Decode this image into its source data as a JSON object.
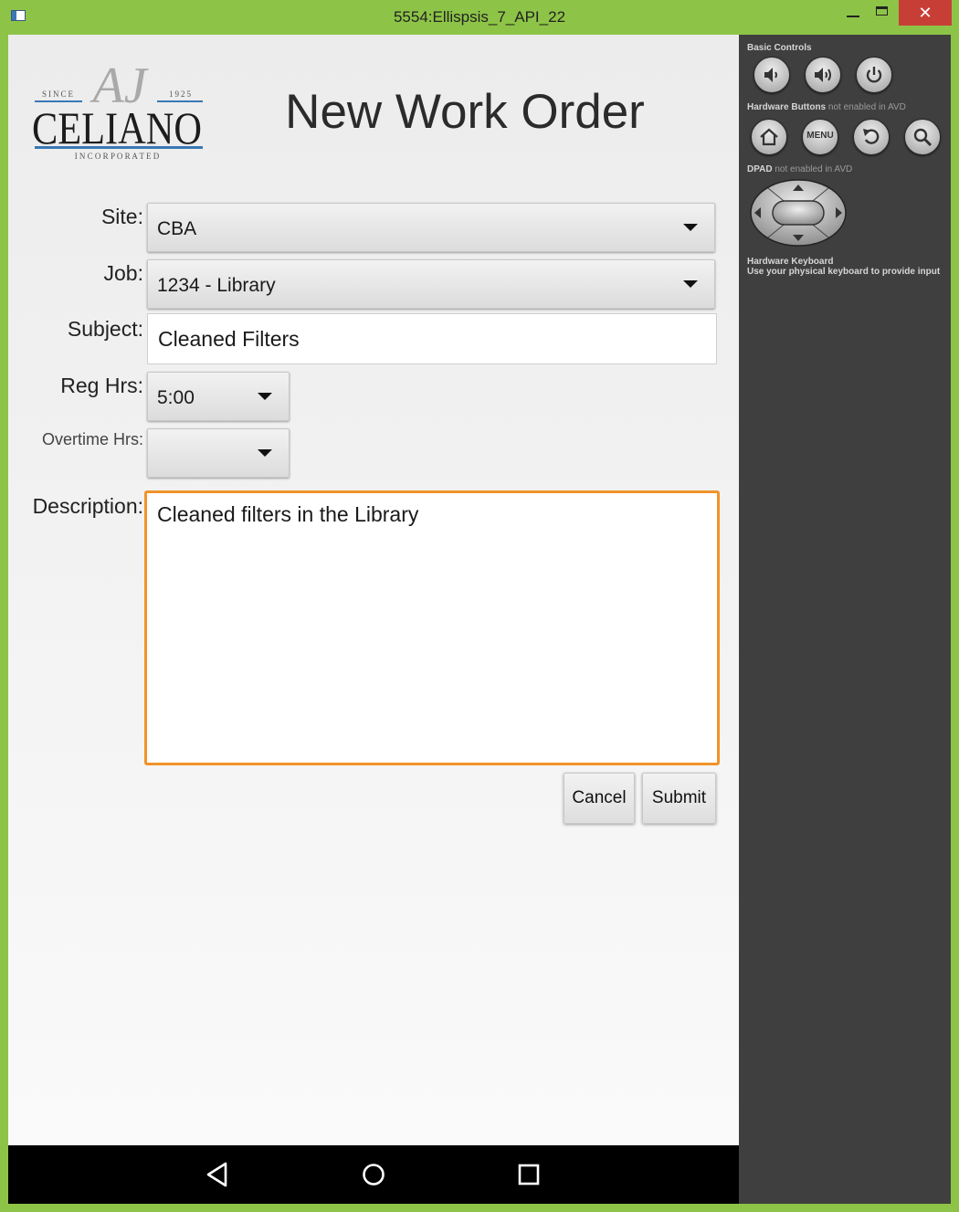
{
  "window": {
    "title": "5554:Ellispsis_7_API_22",
    "close_glyph": "✕"
  },
  "logo": {
    "monogram": "AJ",
    "since": "SINCE",
    "year": "1925",
    "name": "CELIANO",
    "sub": "I N C O R P O R A T E D"
  },
  "form": {
    "title": "New Work Order",
    "site": {
      "label": "Site:",
      "value": "CBA"
    },
    "job": {
      "label": "Job:",
      "value": "1234 - Library"
    },
    "subject": {
      "label": "Subject:",
      "value": "Cleaned Filters"
    },
    "reg_hrs": {
      "label": "Reg Hrs:",
      "value": "5:00"
    },
    "overtime_hrs": {
      "label": "Overtime Hrs:",
      "value": ""
    },
    "description": {
      "label": "Description:",
      "value": "Cleaned filters in the Library"
    },
    "cancel_label": "Cancel",
    "submit_label": "Submit"
  },
  "navbar": {
    "icons": [
      "back-icon",
      "home-icon",
      "recents-icon"
    ]
  },
  "panel": {
    "basic_controls": "Basic Controls",
    "hw_buttons": "Hardware Buttons",
    "hw_buttons_note": "not enabled in AVD",
    "menu_label": "MENU",
    "dpad": "DPAD",
    "dpad_note": "not enabled in AVD",
    "keyboard_title": "Hardware Keyboard",
    "keyboard_note": "Use your physical keyboard to provide input"
  },
  "colors": {
    "window_frame": "#8dc447",
    "focus_border": "#f0932a",
    "logo_blue": "#3a78b5",
    "panel_bg": "#3f3f3f"
  }
}
